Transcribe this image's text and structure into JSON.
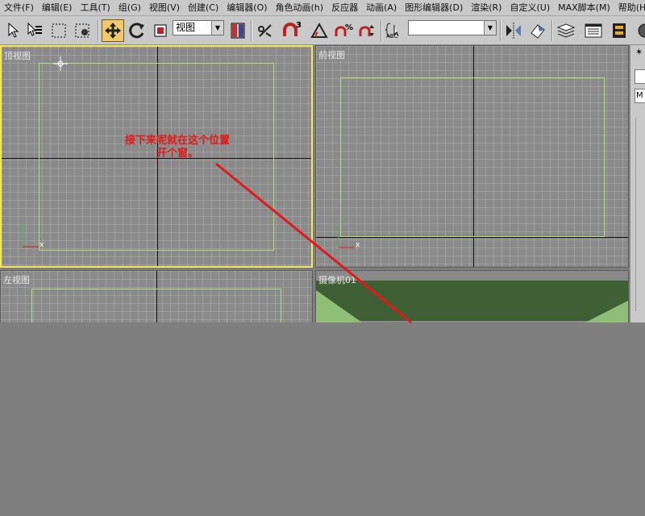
{
  "menu": [
    "文件(F)",
    "编辑(E)",
    "工具(T)",
    "组(G)",
    "视图(V)",
    "创建(C)",
    "编辑器(O)",
    "角色动画(h)",
    "反应器",
    "动画(A)",
    "图形编辑器(D)",
    "渲染(R)",
    "自定义(U)",
    "MAX脚本(M)",
    "帮助(H)"
  ],
  "toolbar": {
    "coord_dropdown": "视图",
    "selection_set_dropdown": "",
    "snap_label": "3",
    "abc_label": "ABC"
  },
  "viewports": {
    "top": {
      "label": "顶视图",
      "active": true
    },
    "front": {
      "label": "前视图"
    },
    "left": {
      "label": "左视图"
    },
    "camera": {
      "label": "摄像机01"
    }
  },
  "axes": {
    "x": "x",
    "y": "y"
  },
  "right_panel": {
    "field": "M"
  },
  "annotation": {
    "line1": "接下来呢就在这个位置",
    "line2": "开个窗。",
    "color": "#e31919"
  },
  "colors": {
    "active_border": "#f2e65a",
    "object_outline": "#b8e070",
    "camera_floor": "#3f6035",
    "camera_wall": "#8fbf77"
  }
}
